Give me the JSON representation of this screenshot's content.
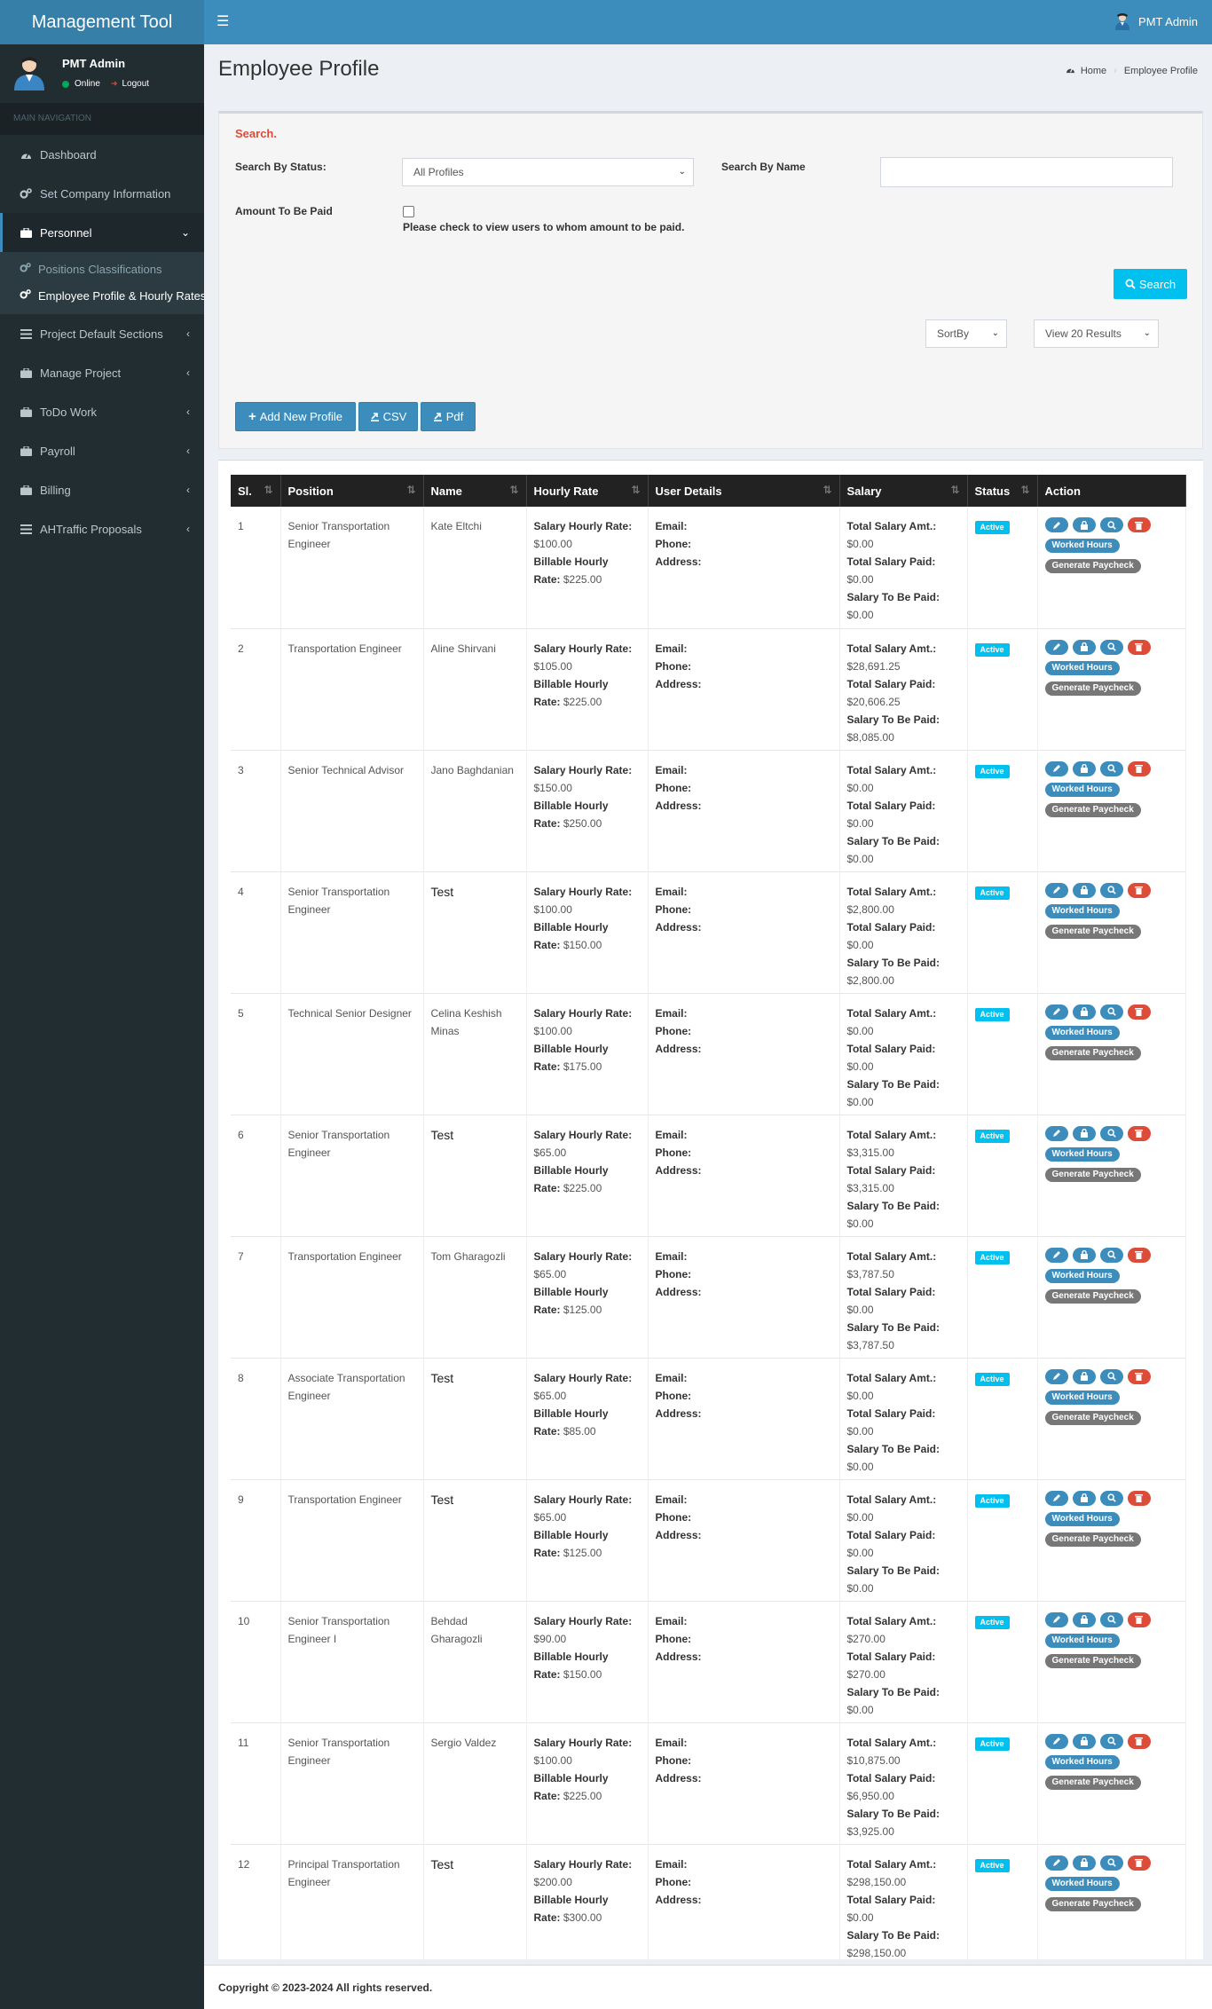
{
  "app": {
    "title": "Management Tool"
  },
  "header": {
    "user_name": "PMT Admin"
  },
  "sidebar": {
    "user_name": "PMT Admin",
    "status": "Online",
    "logout": "Logout",
    "nav_header": "MAIN NAVIGATION",
    "items": [
      {
        "label": "Dashboard",
        "icon": "dashboard-icon"
      },
      {
        "label": "Set Company Information",
        "icon": "cogs-icon"
      },
      {
        "label": "Personnel",
        "icon": "briefcase-icon"
      },
      {
        "label": "Project Default Sections",
        "icon": "list-icon"
      },
      {
        "label": "Manage Project",
        "icon": "briefcase-icon"
      },
      {
        "label": "ToDo Work",
        "icon": "briefcase-icon"
      },
      {
        "label": "Payroll",
        "icon": "briefcase-icon"
      },
      {
        "label": "Billing",
        "icon": "briefcase-icon"
      },
      {
        "label": "AHTraffic Proposals",
        "icon": "list-icon"
      }
    ],
    "sub_items": [
      {
        "label": "Positions Classifications"
      },
      {
        "label": "Employee Profile & Hourly Rates"
      }
    ]
  },
  "page": {
    "title": "Employee Profile",
    "breadcrumb": {
      "home": "Home",
      "current": "Employee Profile"
    }
  },
  "search": {
    "title": "Search.",
    "status_label": "Search By Status:",
    "status_value": "All Profiles",
    "name_label": "Search By Name",
    "name_value": "",
    "amount_label": "Amount To Be Paid",
    "amount_text": "Please check to view users to whom amount to be paid.",
    "search_button": "Search",
    "sortby": "SortBy",
    "results": "View 20 Results",
    "add_button": "Add New Profile",
    "csv_button": "CSV",
    "pdf_button": "Pdf"
  },
  "table": {
    "headers": [
      "Sl.",
      "Position",
      "Name",
      "Hourly Rate",
      "User Details",
      "Salary",
      "Status",
      "Action"
    ],
    "labels": {
      "salary_hourly": "Salary Hourly Rate:",
      "billable_hourly": "Billable Hourly",
      "rate": "Rate:",
      "email": "Email:",
      "phone": "Phone:",
      "address": "Address:",
      "total_salary_amt": "Total Salary Amt.:",
      "total_salary_paid": "Total Salary Paid:",
      "salary_to_be_paid": "Salary To Be Paid:",
      "worked_hours": "Worked Hours",
      "generate_paycheck": "Generate Paycheck"
    },
    "rows": [
      {
        "sl": "1",
        "position": "Senior Transportation Engineer",
        "name": "Kate Eltchi",
        "salary_rate": "$100.00",
        "billable_rate": "$225.00",
        "total_amt": "$0.00",
        "total_paid": "$0.00",
        "to_be_paid": "$0.00",
        "status": "Active"
      },
      {
        "sl": "2",
        "position": "Transportation Engineer",
        "name": "Aline Shirvani",
        "salary_rate": "$105.00",
        "billable_rate": "$225.00",
        "total_amt": "$28,691.25",
        "total_paid": "$20,606.25",
        "to_be_paid": "$8,085.00",
        "status": "Active"
      },
      {
        "sl": "3",
        "position": "Senior Technical Advisor",
        "name": "Jano Baghdanian",
        "salary_rate": "$150.00",
        "billable_rate": "$250.00",
        "total_amt": "$0.00",
        "total_paid": "$0.00",
        "to_be_paid": "$0.00",
        "status": "Active"
      },
      {
        "sl": "4",
        "position": "Senior Transportation Engineer",
        "name": "Test",
        "salary_rate": "$100.00",
        "billable_rate": "$150.00",
        "total_amt": "$2,800.00",
        "total_paid": "$0.00",
        "to_be_paid": "$2,800.00",
        "status": "Active"
      },
      {
        "sl": "5",
        "position": "Technical Senior Designer",
        "name": "Celina Keshish Minas",
        "salary_rate": "$100.00",
        "billable_rate": "$175.00",
        "total_amt": "$0.00",
        "total_paid": "$0.00",
        "to_be_paid": "$0.00",
        "status": "Active"
      },
      {
        "sl": "6",
        "position": "Senior Transportation Engineer",
        "name": "Test",
        "salary_rate": "$65.00",
        "billable_rate": "$225.00",
        "total_amt": "$3,315.00",
        "total_paid": "$3,315.00",
        "to_be_paid": "$0.00",
        "status": "Active"
      },
      {
        "sl": "7",
        "position": "Transportation Engineer",
        "name": "Tom Gharagozli",
        "salary_rate": "$65.00",
        "billable_rate": "$125.00",
        "total_amt": "$3,787.50",
        "total_paid": "$0.00",
        "to_be_paid": "$3,787.50",
        "status": "Active"
      },
      {
        "sl": "8",
        "position": "Associate Transportation Engineer",
        "name": "Test",
        "salary_rate": "$65.00",
        "billable_rate": "$85.00",
        "total_amt": "$0.00",
        "total_paid": "$0.00",
        "to_be_paid": "$0.00",
        "status": "Active"
      },
      {
        "sl": "9",
        "position": "Transportation Engineer",
        "name": "Test",
        "salary_rate": "$65.00",
        "billable_rate": "$125.00",
        "total_amt": "$0.00",
        "total_paid": "$0.00",
        "to_be_paid": "$0.00",
        "status": "Active"
      },
      {
        "sl": "10",
        "position": "Senior Transportation Engineer I",
        "name": "Behdad Gharagozli",
        "salary_rate": "$90.00",
        "billable_rate": "$150.00",
        "total_amt": "$270.00",
        "total_paid": "$270.00",
        "to_be_paid": "$0.00",
        "status": "Active"
      },
      {
        "sl": "11",
        "position": "Senior Transportation Engineer",
        "name": "Sergio Valdez",
        "salary_rate": "$100.00",
        "billable_rate": "$225.00",
        "total_amt": "$10,875.00",
        "total_paid": "$6,950.00",
        "to_be_paid": "$3,925.00",
        "status": "Active"
      },
      {
        "sl": "12",
        "position": "Principal Transportation Engineer",
        "name": "Test",
        "salary_rate": "$200.00",
        "billable_rate": "$300.00",
        "total_amt": "$298,150.00",
        "total_paid": "$0.00",
        "to_be_paid": "$298,150.00",
        "status": "Active"
      }
    ]
  },
  "footer": {
    "text": "Copyright © 2023-2024 All rights reserved."
  }
}
